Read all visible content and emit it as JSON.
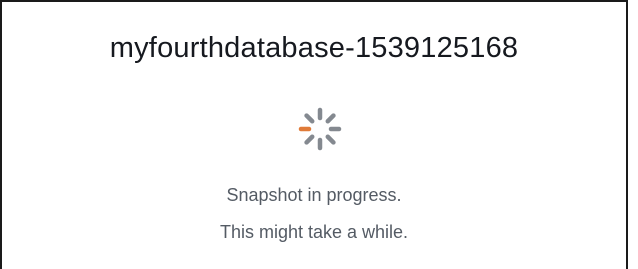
{
  "snapshot": {
    "title": "myfourthdatabase-1539125168",
    "status_line1": "Snapshot in progress.",
    "status_line2": "This might take a while."
  },
  "spinner": {
    "icon": "loading-spinner-icon",
    "accent_color": "#e07b39",
    "segment_color": "#6f757d"
  }
}
